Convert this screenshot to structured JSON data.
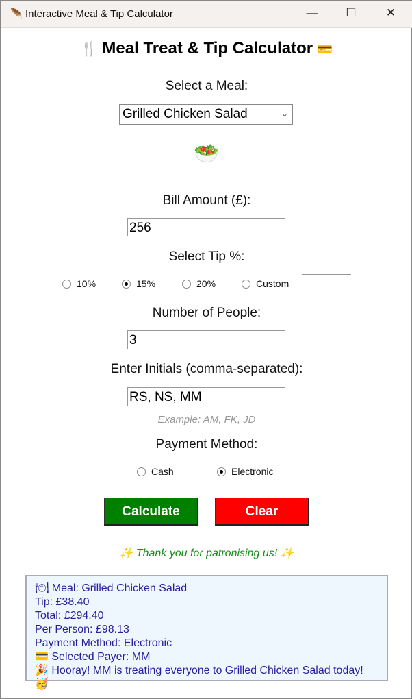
{
  "window": {
    "title": "Interactive Meal & Tip Calculator",
    "minimize": "—",
    "maximize": "☐",
    "close": "✕"
  },
  "header": {
    "title": "Meal Treat & Tip Calculator",
    "left_icon": "🍴",
    "right_icon": "💳"
  },
  "meal": {
    "label": "Select a Meal:",
    "selected": "Grilled Chicken Salad",
    "icon": "🥗"
  },
  "bill": {
    "label": "Bill Amount (£):",
    "value": "256"
  },
  "tip": {
    "label": "Select Tip %:",
    "options": [
      "10%",
      "15%",
      "20%",
      "Custom"
    ],
    "selected": "15%",
    "custom_value": ""
  },
  "people": {
    "label": "Number of People:",
    "value": "3"
  },
  "initials": {
    "label": "Enter Initials (comma-separated):",
    "value": "RS, NS, MM",
    "example": "Example: AM, FK, JD"
  },
  "payment": {
    "label": "Payment Method:",
    "options": [
      "Cash",
      "Electronic"
    ],
    "selected": "Electronic"
  },
  "buttons": {
    "calculate": "Calculate",
    "clear": "Clear"
  },
  "thanks": "✨ Thank you for patronising us! ✨",
  "result": {
    "lines": [
      "🍽 Meal: Grilled Chicken Salad",
      "Tip: £38.40",
      "Total: £294.40",
      "Per Person: £98.13",
      "Payment Method: Electronic",
      "💳 Selected Payer: MM",
      "🎉 Hooray! MM is treating everyone to Grilled Chicken Salad today! 🥳"
    ]
  },
  "colors": {
    "calculate": "#008000",
    "clear": "#ff0000",
    "thanks": "#1a8a1a",
    "result_text": "#2a1f9a",
    "result_bg": "#eef6fe"
  }
}
